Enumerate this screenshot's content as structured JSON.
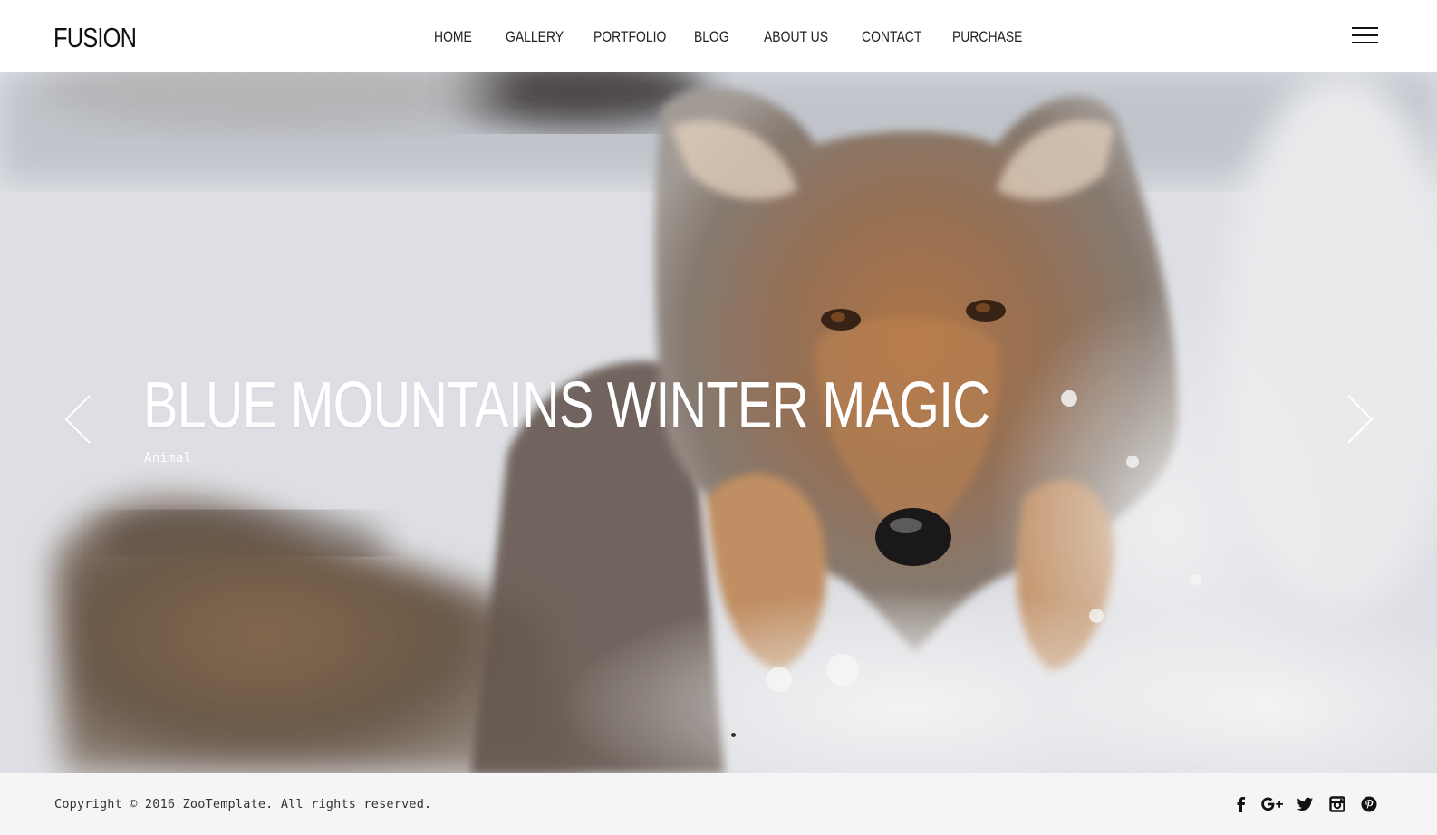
{
  "header": {
    "logo": "FUSION",
    "nav": [
      {
        "label": "HOME"
      },
      {
        "label": "GALLERY"
      },
      {
        "label": "PORTFOLIO"
      },
      {
        "label": "BLOG"
      },
      {
        "label": "ABOUT US"
      },
      {
        "label": "CONTACT"
      },
      {
        "label": "PURCHASE"
      }
    ],
    "menu_icon": "hamburger-menu-icon"
  },
  "hero": {
    "title": "BLUE MOUNTAINS WINTER MAGIC",
    "category": "Animal",
    "prev_icon": "chevron-left-icon",
    "next_icon": "chevron-right-icon",
    "slide_indicator": "slider-dot"
  },
  "footer": {
    "copyright": "Copyright © 2016 ZooTemplate. All rights reserved.",
    "social": [
      {
        "icon": "facebook-icon"
      },
      {
        "icon": "google-plus-icon"
      },
      {
        "icon": "twitter-icon"
      },
      {
        "icon": "instagram-icon"
      },
      {
        "icon": "pinterest-icon"
      }
    ]
  },
  "colors": {
    "text_dark": "#111111",
    "footer_bg": "#f5f5f5",
    "hero_text": "#ffffff"
  }
}
